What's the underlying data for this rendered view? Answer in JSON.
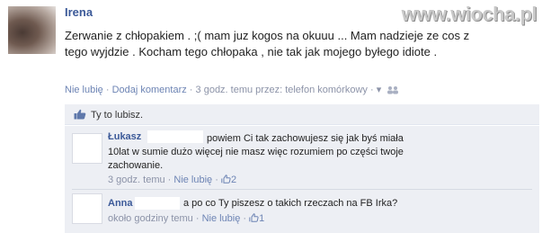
{
  "watermark": "www.wiocha.pl",
  "post": {
    "author": "Irena",
    "text": "Zerwanie z chłopakiem . ;( mam juz kogos na okuuu ... Mam nadzieje ze cos z tego wyjdzie . Kocham tego chłopaka , nie tak jak mojego byłego idiote .",
    "unlike_label": "Nie lubię",
    "comment_label": "Dodaj komentarz",
    "time_via": "3 godz. temu przez: telefon komórkowy",
    "sep": " · ",
    "chevron": "▾"
  },
  "likes": {
    "text": "Ty to lubisz."
  },
  "comments": [
    {
      "author": "Łukasz",
      "text_first": "powiem Ci tak zachowujesz się jak byś miała",
      "text_rest": "10lat w sumie dużo więcej nie masz więc rozumiem po części twoje zachowanie.",
      "time": "3 godz. temu",
      "unlike_label": "Nie lubię",
      "like_count": "2"
    },
    {
      "author": "Anna",
      "text": "a po co Ty piszesz o takich rzeczach na FB Irka?",
      "time": "około godziny temu",
      "unlike_label": "Nie lubię",
      "like_count": "1"
    }
  ],
  "colors": {
    "link": "#3b5998",
    "meta": "#8c93a8",
    "comment_bg": "#edeff4"
  }
}
